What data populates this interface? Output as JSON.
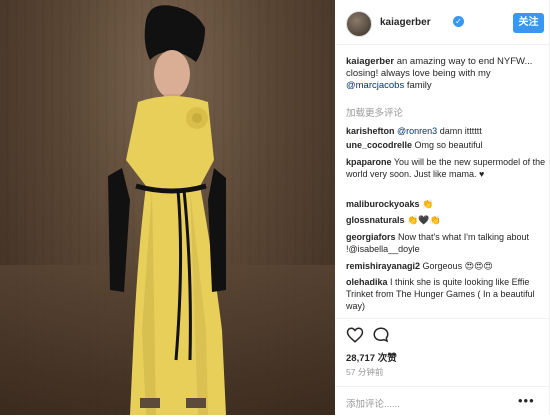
{
  "post": {
    "username": "kaiagerber",
    "follow_label": "关注",
    "caption_text": " an amazing way to end NYFW... closing! always love being with my ",
    "caption_mention": "@marcjacobs",
    "caption_end": " family",
    "load_more": "加载更多评论",
    "likes": "28,717 次赞",
    "time": "57 分钟前",
    "add_comment_placeholder": "添加评论......",
    "more_glyph": "•••"
  },
  "comments": [
    {
      "user": "karishefton",
      "mention": "@ronren3",
      "text": " damn itttttt"
    },
    {
      "user": "une_cocodrelle",
      "text": " Omg so beautiful"
    },
    {
      "user": "kpaparone",
      "text": " You will be the new supermodel of the world very soon. Just like mama. ♥"
    },
    {
      "user": "maliburockyoaks",
      "text": " 👏"
    },
    {
      "user": "glossnaturals",
      "text": " 👏🖤👏"
    },
    {
      "user": "georgiafors",
      "text": " Now that's what I'm talking about !@isabella__doyle"
    },
    {
      "user": "remishirayanagi2",
      "text": " Gorgeous 😍😍😍"
    },
    {
      "user": "olehadika",
      "text": " I think she is quite looking like Effie Trinket from The Hunger Games ( In a beautiful way)"
    }
  ],
  "colors": {
    "accent": "#3897f0",
    "mention": "#003569",
    "dress": "#e7cf5a"
  },
  "icons": [
    "verified-badge-icon",
    "heart-icon",
    "comment-icon",
    "more-options-icon"
  ]
}
